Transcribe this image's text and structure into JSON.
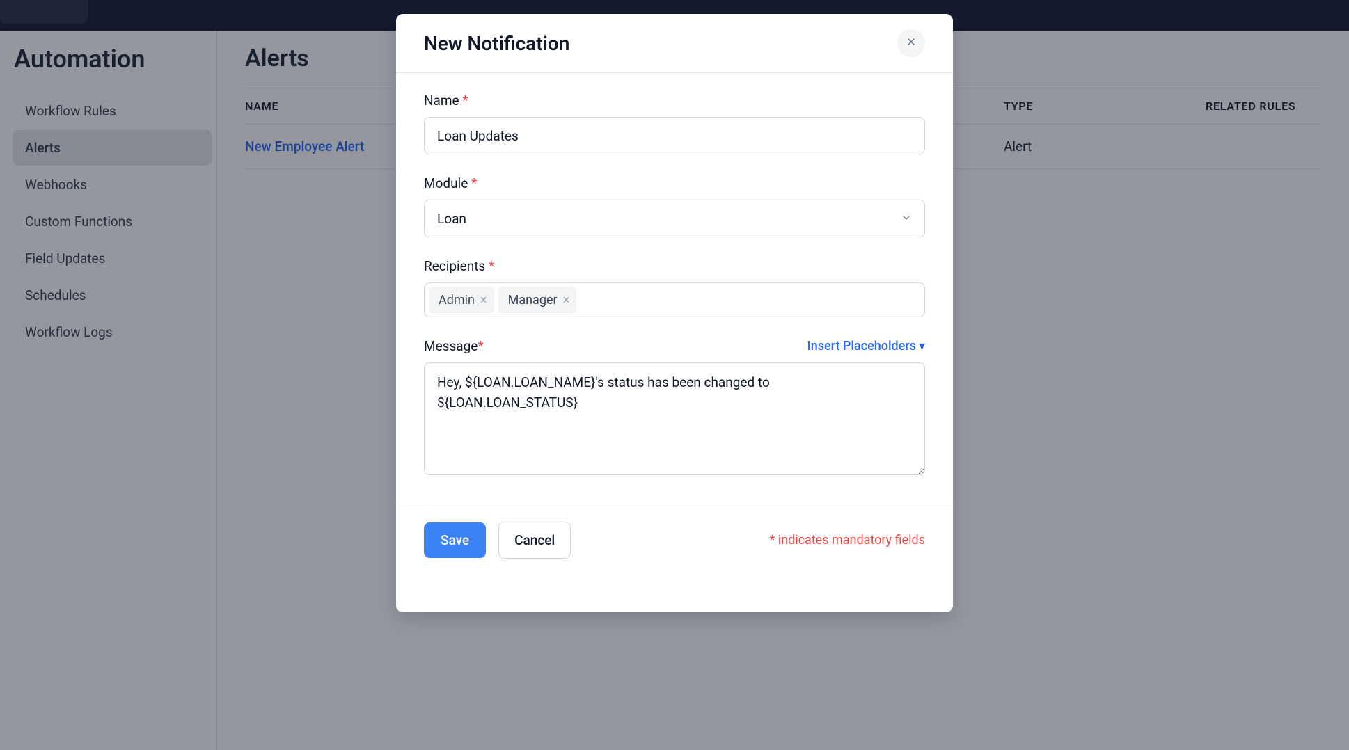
{
  "sidebar": {
    "title": "Automation",
    "items": [
      {
        "label": "Workflow Rules"
      },
      {
        "label": "Alerts"
      },
      {
        "label": "Webhooks"
      },
      {
        "label": "Custom Functions"
      },
      {
        "label": "Field Updates"
      },
      {
        "label": "Schedules"
      },
      {
        "label": "Workflow Logs"
      }
    ]
  },
  "page": {
    "title": "Alerts",
    "columns": {
      "name": "Name",
      "type": "Type",
      "related": "Related Rules"
    },
    "rows": [
      {
        "name": "New Employee Alert",
        "type": "Alert"
      }
    ]
  },
  "modal": {
    "title": "New Notification",
    "name_label": "Name",
    "name_value": "Loan Updates",
    "module_label": "Module",
    "module_value": "Loan",
    "recipients_label": "Recipients",
    "recipients": [
      {
        "label": "Admin"
      },
      {
        "label": "Manager"
      }
    ],
    "message_label": "Message",
    "insert_placeholders": "Insert Placeholders",
    "message_value": "Hey, ${LOAN.LOAN_NAME}'s status has been changed to ${LOAN.LOAN_STATUS}",
    "save": "Save",
    "cancel": "Cancel",
    "mandatory_note": "* indicates mandatory fields"
  }
}
